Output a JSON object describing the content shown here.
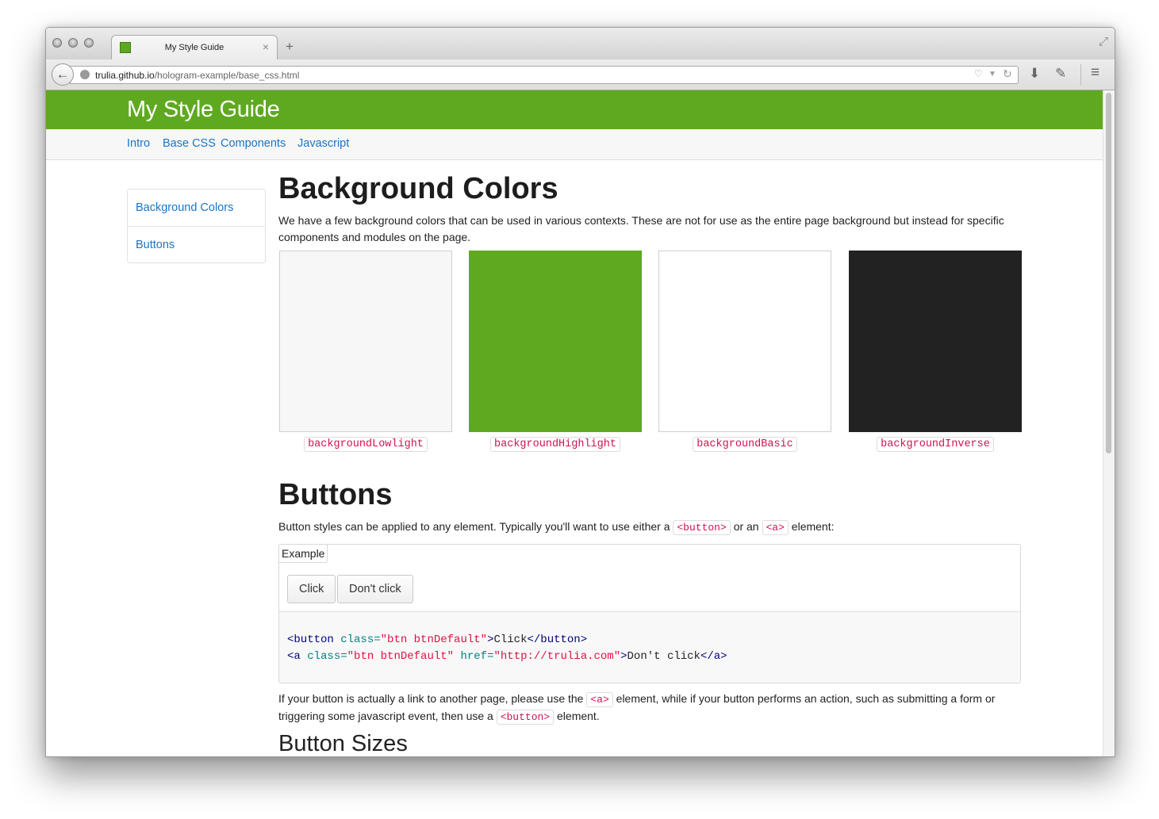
{
  "browser": {
    "tab_title": "My Style Guide",
    "url_domain": "trulia.github.io",
    "url_path": "/hologram-example/base_css.html"
  },
  "site": {
    "title": "My Style Guide",
    "nav": [
      "Intro",
      "Base CSS",
      "Components",
      "Javascript"
    ],
    "colors": {
      "header_green": "#5fa920",
      "link_blue": "#1a74c7",
      "code_red": "#d0134f"
    }
  },
  "sidebar": {
    "items": [
      "Background Colors",
      "Buttons"
    ]
  },
  "background_colors": {
    "heading": "Background Colors",
    "description": "We have a few background colors that can be used in various contexts. These are not for use as the entire page background but instead for specific components and modules on the page.",
    "swatches": [
      {
        "name": "backgroundLowlight",
        "color": "#f7f7f7"
      },
      {
        "name": "backgroundHighlight",
        "color": "#5fa920"
      },
      {
        "name": "backgroundBasic",
        "color": "#ffffff"
      },
      {
        "name": "backgroundInverse",
        "color": "#222222"
      }
    ]
  },
  "buttons": {
    "heading": "Buttons",
    "intro_1": "Button styles can be applied to any element. Typically you'll want to use either a",
    "intro_code_1": "<button>",
    "intro_2": "or an",
    "intro_code_2": "<a>",
    "intro_3": "element:",
    "example_label": "Example",
    "btn_click": "Click",
    "btn_dont_click": "Don't click",
    "code": {
      "l1_open": "<button",
      "l1_attr": "class=",
      "l1_val": "\"btn btnDefault\"",
      "l1_gt": ">",
      "l1_text": "Click",
      "l1_close": "</button>",
      "l2_open": "<a",
      "l2_attr1": "class=",
      "l2_val1": "\"btn btnDefault\"",
      "l2_attr2": "href=",
      "l2_val2": "\"http://trulia.com\"",
      "l2_gt": ">",
      "l2_text": "Don't click",
      "l2_close": "</a>"
    },
    "after_1": "If your button is actually a link to another page, please use the",
    "after_code_1": "<a>",
    "after_2": "element, while if your button performs an action, such as submitting a form or triggering some javascript event, then use a",
    "after_code_2": "<button>",
    "after_3": "element.",
    "sizes_heading": "Button Sizes"
  }
}
